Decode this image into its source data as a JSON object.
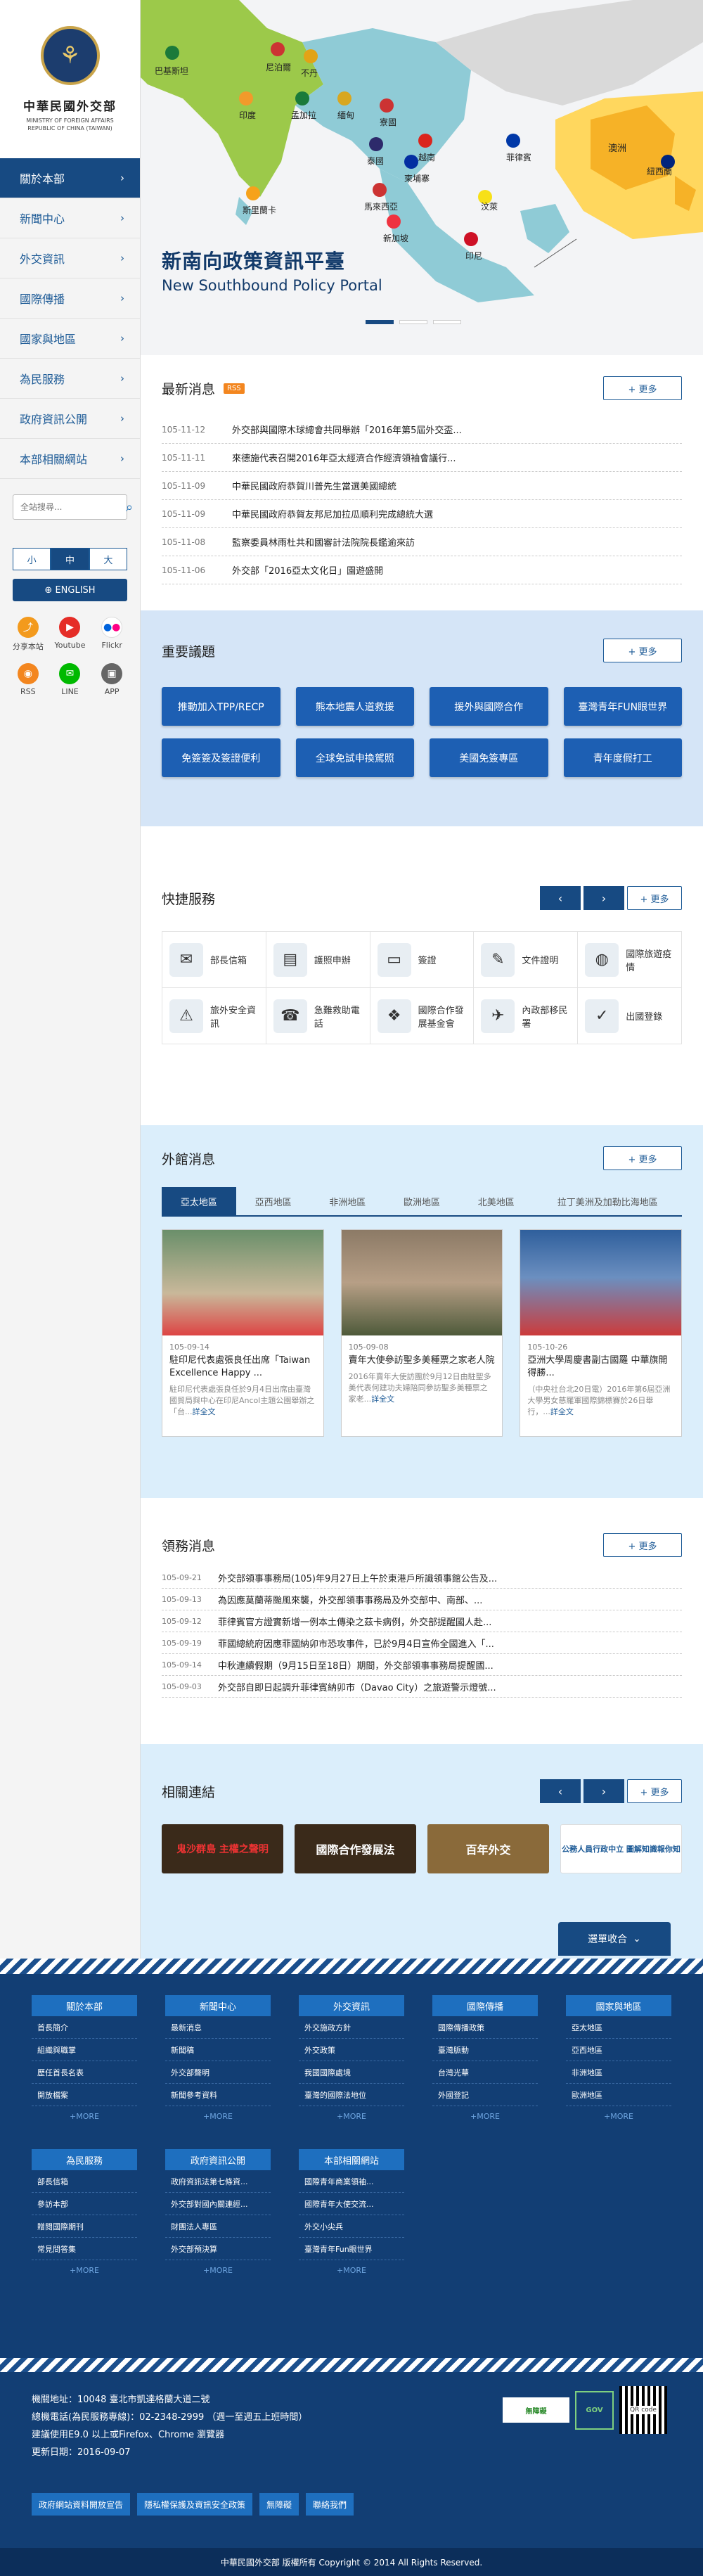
{
  "brand": {
    "name_cn": "中華民國外交部",
    "name_en": "MINISTRY OF FOREIGN AFFAIRS REPUBLIC OF CHINA (TAIWAN)"
  },
  "nav": [
    {
      "label": "關於本部"
    },
    {
      "label": "新聞中心"
    },
    {
      "label": "外交資訊"
    },
    {
      "label": "國際傳播"
    },
    {
      "label": "國家與地區"
    },
    {
      "label": "為民服務"
    },
    {
      "label": "政府資訊公開"
    },
    {
      "label": "本部相關網站"
    }
  ],
  "search": {
    "placeholder": "全站搜尋..."
  },
  "font_sizes": [
    "小",
    "中",
    "大"
  ],
  "english_label": "ENGLISH",
  "social": [
    {
      "label": "分享本站",
      "icon": "share-icon"
    },
    {
      "label": "Youtube",
      "icon": "youtube-icon"
    },
    {
      "label": "Flickr",
      "icon": "flickr-icon"
    },
    {
      "label": "RSS",
      "icon": "rss-icon"
    },
    {
      "label": "LINE",
      "icon": "line-icon"
    },
    {
      "label": "APP",
      "icon": "app-icon"
    }
  ],
  "hero": {
    "title": "新南向政策資訊平臺",
    "subtitle": "New Southbound Policy Portal",
    "countries": [
      "巴基斯坦",
      "尼泊爾",
      "不丹",
      "印度",
      "孟加拉",
      "緬甸",
      "寮國",
      "越南",
      "泰國",
      "柬埔寨",
      "斯里蘭卡",
      "馬來西亞",
      "菲律賓",
      "汶萊",
      "新加坡",
      "印尼",
      "澳洲",
      "紐西蘭"
    ]
  },
  "latest_news": {
    "title": "最新消息",
    "rss": "RSS",
    "more": "+ 更多",
    "items": [
      {
        "date": "105-11-12",
        "text": "外交部與國際木球總會共同舉辦「2016年第5屆外交盃..."
      },
      {
        "date": "105-11-11",
        "text": "來德施代表召開2016年亞太經濟合作經濟領袖會議行..."
      },
      {
        "date": "105-11-09",
        "text": "中華民國政府恭賀川普先生當選美國總統"
      },
      {
        "date": "105-11-09",
        "text": "中華民國政府恭賀友邦尼加拉瓜順利完成總統大選"
      },
      {
        "date": "105-11-08",
        "text": "監察委員林雨杜共和國審計法院院長鑑逾來訪"
      },
      {
        "date": "105-11-06",
        "text": "外交部「2016亞太文化日」園遊盛開"
      }
    ]
  },
  "key_issues": {
    "title": "重要議題",
    "more": "+ 更多",
    "items": [
      "推動加入TPP/RECP",
      "熊本地震人道救援",
      "援外與國際合作",
      "臺灣青年FUN眼世界",
      "免簽簽及簽證便利",
      "全球免試申換駕照",
      "美國免簽專區",
      "青年度假打工"
    ]
  },
  "quick_services": {
    "title": "快捷服務",
    "more": "+ 更多",
    "items": [
      {
        "label": "部長信箱",
        "icon": "mail-icon"
      },
      {
        "label": "護照申辦",
        "icon": "passport-icon"
      },
      {
        "label": "簽證",
        "icon": "visa-icon"
      },
      {
        "label": "文件證明",
        "icon": "document-icon"
      },
      {
        "label": "國際旅遊疫情",
        "icon": "globe-icon"
      },
      {
        "label": "旅外安全資訊",
        "icon": "safety-icon"
      },
      {
        "label": "急難救助電話",
        "icon": "phone-icon"
      },
      {
        "label": "國際合作發展基金會",
        "icon": "fund-icon"
      },
      {
        "label": "內政部移民署",
        "icon": "immigration-icon"
      },
      {
        "label": "出國登錄",
        "icon": "register-icon"
      }
    ]
  },
  "dept_news": {
    "title": "外館消息",
    "more": "+ 更多",
    "tabs": [
      "亞太地區",
      "亞西地區",
      "非洲地區",
      "歐洲地區",
      "北美地區",
      "拉丁美洲及加勒比海地區"
    ],
    "cards": [
      {
        "date": "105-09-14",
        "title": "駐印尼代表處張良任出席「Taiwan Excellence Happy ...",
        "desc": "駐印尼代表處張良任於9月4日出席由臺灣國貿局與中心在印尼Ancol主題公園舉辦之「台...",
        "link": "詳全文"
      },
      {
        "date": "105-09-08",
        "title": "賣年大使參訪聖多美種票之家老人院",
        "desc": "2016年賣年大使訪團於9月12日由駐聖多美代表何建功夫婦陪同參訪聖多美種票之家老...",
        "link": "詳全文"
      },
      {
        "date": "105-10-26",
        "title": "亞洲大學周慶書副古國羅 中華旗開得勝...",
        "desc": "（中央社台北20日電）2016年第6屆亞洲大學男女慈羅軍國際錦標賽於26日舉行，...",
        "link": "詳全文"
      }
    ]
  },
  "consular": {
    "title": "領務消息",
    "more": "+ 更多",
    "items": [
      {
        "date": "105-09-21",
        "text": "外交部領事事務局(105)年9月27日上午於東港戶所識領事館公告及..."
      },
      {
        "date": "105-09-13",
        "text": "為因應莫蘭蒂颱風來襲，外交部領事事務局及外交部中、南部、..."
      },
      {
        "date": "105-09-12",
        "text": "菲律賓官方證實新增一例本土傳染之茲卡病例，外交部提醒國人赴..."
      },
      {
        "date": "105-09-19",
        "text": "菲國總統府因應菲國納卯市恐攻事件，已於9月4日宣佈全國進入「..."
      },
      {
        "date": "105-09-14",
        "text": "中秋連續假期（9月15日至18日）期間，外交部領事事務局提醒國..."
      },
      {
        "date": "105-09-03",
        "text": "外交部自即日起調升菲律賓納卯市（Davao City）之旅遊警示燈號..."
      }
    ]
  },
  "related_links": {
    "title": "相關連結",
    "more": "+ 更多",
    "items": [
      "鬼沙群島 主權之聲明",
      "國際合作發展法",
      "百年外交",
      "公務人員行政中立 圖解知識報你知"
    ]
  },
  "sitemap_button": "選單收合",
  "footer": {
    "columns": [
      {
        "title": "關於本部",
        "items": [
          "首長簡介",
          "組織與職掌",
          "歷任首長名表",
          "開放檔案"
        ],
        "more": "+MORE"
      },
      {
        "title": "新聞中心",
        "items": [
          "最新消息",
          "新聞稿",
          "外交部聲明",
          "新聞參考資料"
        ],
        "more": "+MORE"
      },
      {
        "title": "外交資訊",
        "items": [
          "外交施政方針",
          "外交政策",
          "我國國際處境",
          "臺灣的國際法地位"
        ],
        "more": "+MORE"
      },
      {
        "title": "國際傳播",
        "items": [
          "國際傳播政策",
          "臺灣脈動",
          "台灣光華",
          "外國登記"
        ],
        "more": "+MORE"
      },
      {
        "title": "國家與地區",
        "items": [
          "亞太地區",
          "亞西地區",
          "非洲地區",
          "歐洲地區"
        ],
        "more": "+MORE"
      },
      {
        "title": "為民服務",
        "items": [
          "部長信箱",
          "參訪本部",
          "贈閱國際期刊",
          "常見問答集"
        ],
        "more": "+MORE"
      },
      {
        "title": "政府資訊公開",
        "items": [
          "政府資訊法第七條資...",
          "外交部對國內關連經...",
          "財團法人專區",
          "外交部預決算"
        ],
        "more": "+MORE"
      },
      {
        "title": "本部相關網站",
        "items": [
          "國際青年商業領袖...",
          "國際青年大使交流...",
          "外交小尖兵",
          "臺灣青年Fun眼世界"
        ],
        "more": "+MORE"
      }
    ],
    "address": "機關地址：10048 臺北市凱達格蘭大道二號",
    "phone": "總機電話(為民服務專線)：02-2348-2999 （週一至週五上班時間）",
    "browser": "建議使用E9.0 以上或Firefox、Chrome 瀏覽器",
    "updated": "更新日期：2016-09-07",
    "buttons": [
      "政府網站資料開放宣告",
      "隱私權保護及資訊安全政策",
      "無障礙",
      "聯絡我們"
    ],
    "badges": [
      "無障礙",
      "GOV",
      "QR code"
    ],
    "copyright": "中華民國外交部 版權所有 Copyright © 2014 All Rights Reserved."
  }
}
